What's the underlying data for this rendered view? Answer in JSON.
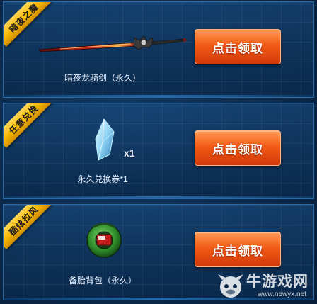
{
  "rewards": [
    {
      "ribbon": "暗夜之魔",
      "item_name": "暗夜龙骑剑（永久）",
      "quantity": "",
      "button_label": "点击领取",
      "icon": "sword-icon"
    },
    {
      "ribbon": "任意兑换",
      "item_name": "永久兑换券*1",
      "quantity": "x1",
      "button_label": "点击领取",
      "icon": "crystal-icon"
    },
    {
      "ribbon": "酷炫拉风",
      "item_name": "备胎背包（永久）",
      "quantity": "",
      "button_label": "点击领取",
      "icon": "tire-backpack-icon"
    }
  ],
  "watermark": {
    "name": "牛游戏网",
    "url": "www.newyx.net"
  },
  "colors": {
    "background": "#0b2747",
    "ribbon": "#f6b800",
    "button": "#f25b16"
  }
}
